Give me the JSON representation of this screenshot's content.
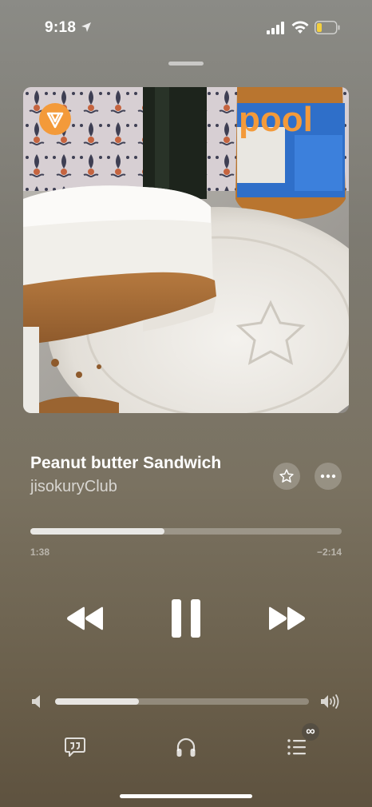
{
  "status": {
    "time": "9:18",
    "battery_color": "#f4d03f"
  },
  "artwork": {
    "logo_text": "pool",
    "logo_color": "#f39a3a"
  },
  "track": {
    "title": "Peanut butter Sandwich",
    "artist": "jisokuryClub"
  },
  "playback": {
    "elapsed": "1:38",
    "remaining": "−2:14",
    "progress": 0.43,
    "is_playing": true
  },
  "volume": {
    "level": 0.33
  },
  "bottom_bar": {
    "autoplay_badge": "∞"
  },
  "icons": [
    "location-arrow-icon",
    "cellular-signal-icon",
    "wifi-icon",
    "battery-icon",
    "star-icon",
    "more-icon",
    "rewind-icon",
    "pause-icon",
    "fast-forward-icon",
    "volume-low-icon",
    "volume-high-icon",
    "lyrics-icon",
    "airplay-headphones-icon",
    "queue-icon",
    "infinity-icon"
  ]
}
